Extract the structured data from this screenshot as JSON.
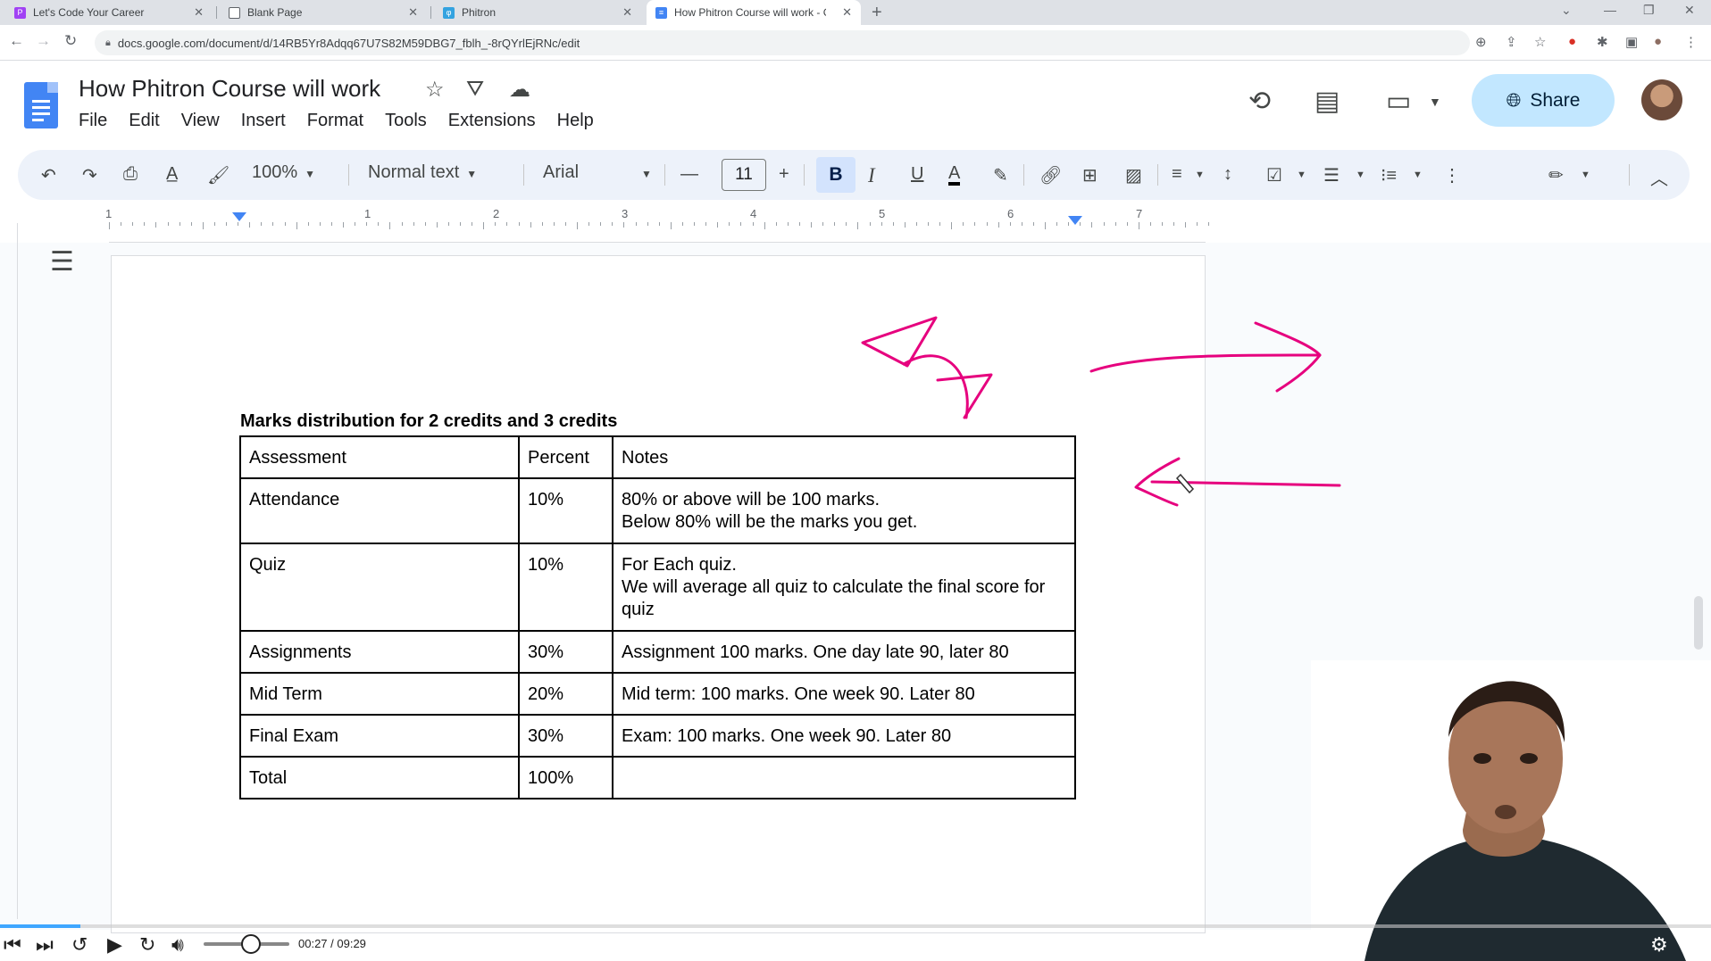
{
  "browser": {
    "tabs": [
      {
        "title": "Let's Code Your Career",
        "fav_color": "#a142f4",
        "active": false
      },
      {
        "title": "Blank Page",
        "fav_color": "#5f6368",
        "active": false
      },
      {
        "title": "Phitron",
        "fav_color": "#34a3e0",
        "active": false
      },
      {
        "title": "How Phitron Course will work - G",
        "fav_color": "#4285f4",
        "active": true
      }
    ],
    "url": "docs.google.com/document/d/14RB5Yr8Adqq67U7S82M59DBG7_fblh_-8rQYrlEjRNc/edit"
  },
  "doc": {
    "title": "How Phitron Course will work",
    "menu": [
      "File",
      "Edit",
      "View",
      "Insert",
      "Format",
      "Tools",
      "Extensions",
      "Help"
    ],
    "share_label": "Share"
  },
  "toolbar": {
    "zoom": "100%",
    "style": "Normal text",
    "font": "Arial",
    "font_size": "11",
    "bold": "B",
    "italic": "I",
    "underline": "U",
    "text_color": "A"
  },
  "ruler": {
    "labels": [
      "1",
      "1",
      "2",
      "3",
      "4",
      "5",
      "6",
      "7"
    ]
  },
  "table": {
    "heading": "Marks distribution for 2 credits and 3 credits",
    "header": [
      "Assessment",
      "Percent",
      "Notes"
    ],
    "rows": [
      {
        "assessment": "Attendance",
        "percent": "10%",
        "notes1": "80% or above will be 100 marks.",
        "notes2": "Below 80% will be the marks you get."
      },
      {
        "assessment": "Quiz",
        "percent": "10%",
        "notes1": "For Each quiz.",
        "notes2": "We will average all quiz to calculate the final score for quiz"
      },
      {
        "assessment": "Assignments",
        "percent": "30%",
        "notes1": "Assignment 100 marks. One day late 90, later 80",
        "notes2": ""
      },
      {
        "assessment": "Mid Term",
        "percent": "20%",
        "notes1": "Mid term: 100 marks. One week 90. Later 80",
        "notes2": ""
      },
      {
        "assessment": "Final Exam",
        "percent": "30%",
        "notes1": "Exam: 100 marks. One week 90. Later 80",
        "notes2": ""
      },
      {
        "assessment": "Total",
        "percent": "100%",
        "notes1": "",
        "notes2": ""
      }
    ]
  },
  "video": {
    "time": "00:27 / 09:29",
    "progress": 0.047,
    "volume": 0.55
  },
  "colors": {
    "ink": "#e6007e",
    "share_bg": "#c2e7ff",
    "toolbar_bg": "#edf2fa",
    "accent": "#4285f4"
  }
}
